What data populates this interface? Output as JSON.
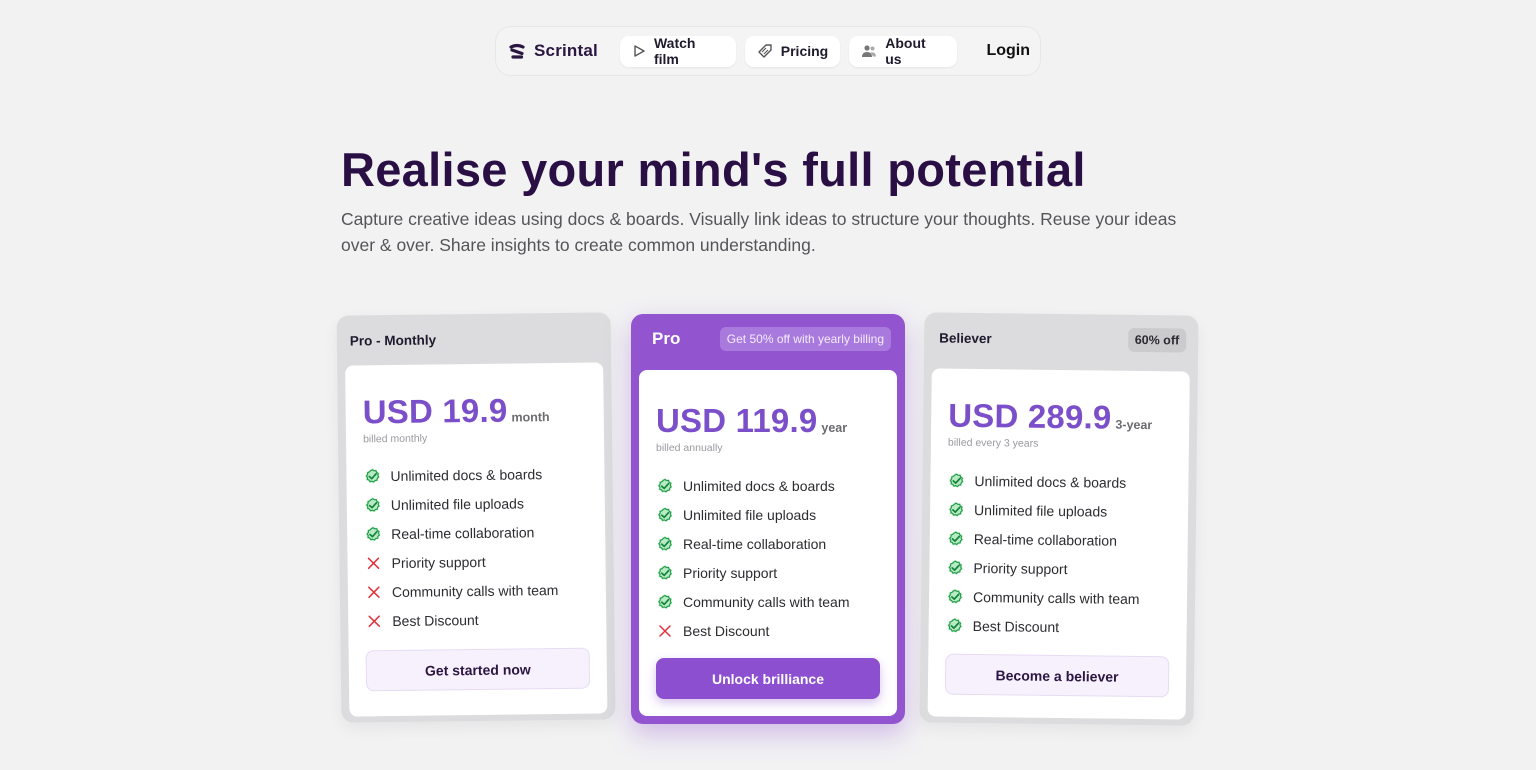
{
  "nav": {
    "brand": "Scrintal",
    "items": [
      {
        "label": "Watch film",
        "icon": "play-icon"
      },
      {
        "label": "Pricing",
        "icon": "tag-icon"
      },
      {
        "label": "About us",
        "icon": "people-icon"
      }
    ],
    "login": "Login"
  },
  "hero": {
    "title": "Realise your mind's full potential",
    "subtitle": "Capture creative ideas using docs & boards. Visually link ideas to structure your thoughts. Reuse your ideas over & over. Share insights to create common understanding."
  },
  "colors": {
    "accent": "#9354d0",
    "price": "#7b4fc9",
    "title": "#2a0f45",
    "check": "#34c759",
    "cross": "#e0323c"
  },
  "plans": [
    {
      "name": "Pro - Monthly",
      "price": "USD 19.9",
      "period": "month",
      "billed": "billed monthly",
      "features": [
        {
          "label": "Unlimited docs & boards",
          "included": true
        },
        {
          "label": "Unlimited file uploads",
          "included": true
        },
        {
          "label": "Real-time collaboration",
          "included": true
        },
        {
          "label": "Priority support",
          "included": false
        },
        {
          "label": "Community calls with team",
          "included": false
        },
        {
          "label": "Best Discount",
          "included": false
        }
      ],
      "cta": "Get started now"
    },
    {
      "name": "Pro",
      "badge": "Get 50% off with yearly billing",
      "price": "USD 119.9",
      "period": "year",
      "billed": "billed annually",
      "features": [
        {
          "label": "Unlimited docs & boards",
          "included": true
        },
        {
          "label": "Unlimited file uploads",
          "included": true
        },
        {
          "label": "Real-time collaboration",
          "included": true
        },
        {
          "label": "Priority support",
          "included": true
        },
        {
          "label": "Community calls with team",
          "included": true
        },
        {
          "label": "Best Discount",
          "included": false
        }
      ],
      "cta": "Unlock brilliance"
    },
    {
      "name": "Believer",
      "badge": "60% off",
      "price": "USD 289.9",
      "period": "3-year",
      "billed": "billed every 3 years",
      "features": [
        {
          "label": "Unlimited docs & boards",
          "included": true
        },
        {
          "label": "Unlimited file uploads",
          "included": true
        },
        {
          "label": "Real-time collaboration",
          "included": true
        },
        {
          "label": "Priority support",
          "included": true
        },
        {
          "label": "Community calls with team",
          "included": true
        },
        {
          "label": "Best Discount",
          "included": true
        }
      ],
      "cta": "Become a believer"
    }
  ]
}
